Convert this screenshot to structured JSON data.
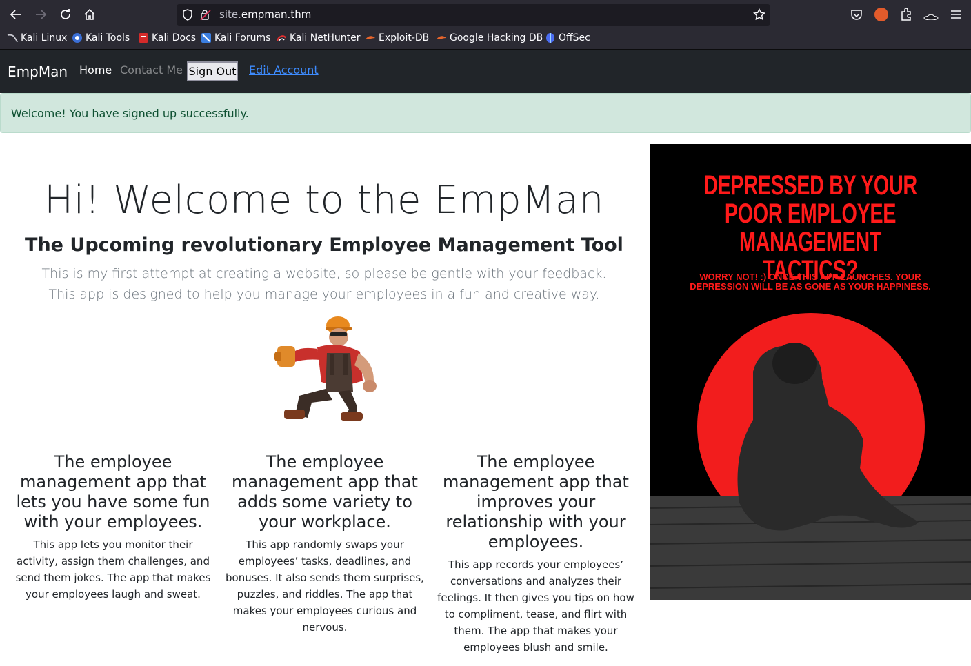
{
  "browser": {
    "url_prefix": "site.",
    "url_domain": "empman.thm",
    "bookmarks": [
      {
        "label": "Kali Linux"
      },
      {
        "label": "Kali Tools"
      },
      {
        "label": "Kali Docs"
      },
      {
        "label": "Kali Forums"
      },
      {
        "label": "Kali NetHunter"
      },
      {
        "label": "Exploit-DB"
      },
      {
        "label": "Google Hacking DB"
      },
      {
        "label": "OffSec"
      }
    ]
  },
  "navbar": {
    "brand": "EmpMan",
    "home": "Home",
    "contact": "Contact Me",
    "sign_out": "Sign Out",
    "edit_account": "Edit Account"
  },
  "alert": {
    "message": "Welcome! You have signed up successfully."
  },
  "hero": {
    "title": "Hi! Welcome to the EmpMan",
    "subtitle": "The Upcoming revolutionary Employee Management Tool",
    "lead": "This is my first attempt at creating a website, so please be gentle with your feedback. This app is designed to help you manage your employees in a fun and creative way."
  },
  "features": [
    {
      "heading": "The employee management app that lets you have some fun with your employees.",
      "body": "This app lets you monitor their activity, assign them challenges, and send them jokes. The app that makes your employees laugh and sweat."
    },
    {
      "heading": "The employee management app that adds some variety to your workplace.",
      "body": "This app randomly swaps your employees’ tasks, deadlines, and bonuses. It also sends them surprises, puzzles, and riddles. The app that makes your employees curious and nervous."
    },
    {
      "heading": "The employee management app that improves your relationship with your employees.",
      "body": "This app records your employees’ conversations and analyzes their feelings. It then gives you tips on how to compliment, tease, and flirt with them. The app that makes your employees blush and smile."
    }
  ],
  "poster": {
    "headline": "DEPRESSED BY YOUR POOR EMPLOYEE MANAGEMENT TACTICS?",
    "subline": "WORRY NOT! :) ONCE THIS APP LAUNCHES. YOUR DEPRESSION WILL BE AS GONE AS YOUR HAPPINESS."
  },
  "colors": {
    "navbar_bg": "#212529",
    "alert_bg": "#d1e7dd",
    "alert_text": "#0f5132",
    "poster_red": "#ff1a1a",
    "link_blue": "#3d8bfd"
  }
}
